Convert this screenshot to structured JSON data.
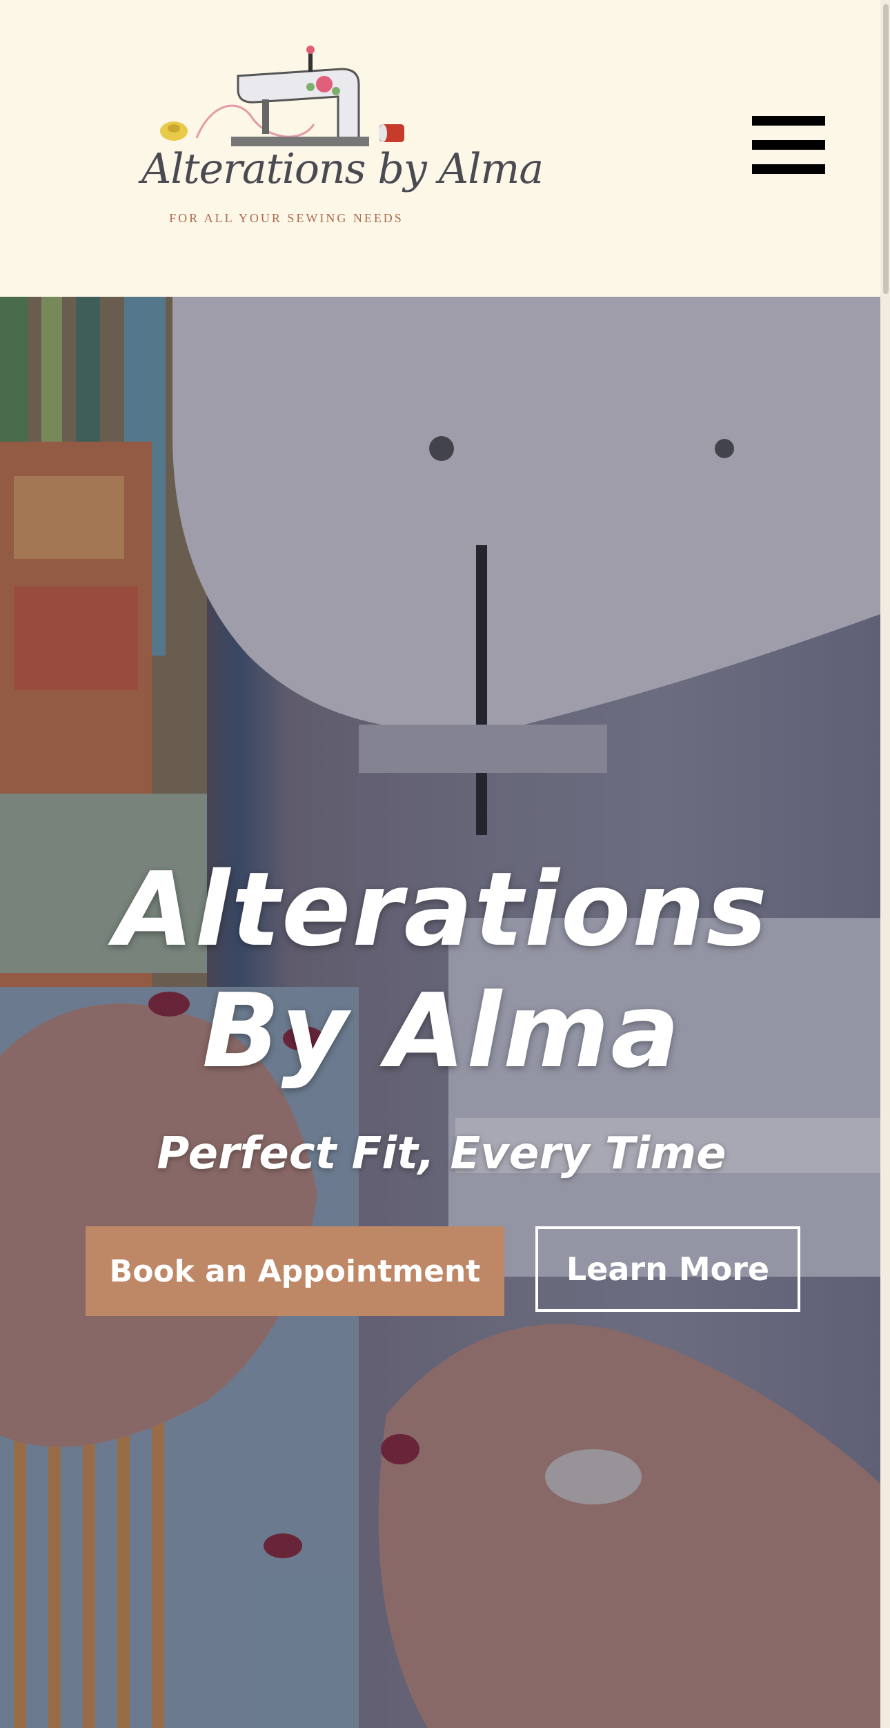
{
  "header": {
    "logo": {
      "name": "Alterations by Alma",
      "tagline": "FOR ALL YOUR SEWING NEEDS",
      "icon": "sewing-machine-icon"
    },
    "menu_icon": "hamburger-menu-icon"
  },
  "hero": {
    "title": "Alterations By Alma",
    "subtitle": "Perfect Fit, Every Time",
    "primary_button": "Book an Appointment",
    "secondary_button": "Learn More",
    "background_image": "sewing-photo"
  },
  "colors": {
    "page_background": "#fdf7e8",
    "accent": "#be8766",
    "logo_text": "#4a4a52",
    "tagline": "#b06a4a"
  }
}
